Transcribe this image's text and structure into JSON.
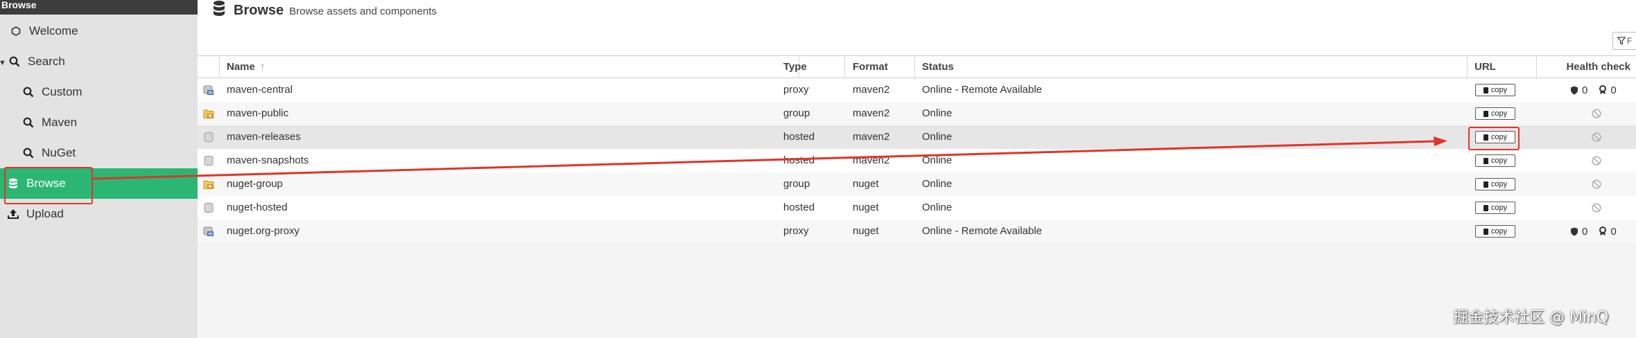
{
  "sidebar": {
    "header": "Browse",
    "items": [
      {
        "label": "Welcome",
        "icon": "hexagon-icon"
      },
      {
        "label": "Search",
        "icon": "search-icon"
      },
      {
        "label": "Custom",
        "icon": "search-icon"
      },
      {
        "label": "Maven",
        "icon": "search-icon"
      },
      {
        "label": "NuGet",
        "icon": "search-icon"
      },
      {
        "label": "Browse",
        "icon": "database-icon",
        "selected": true
      },
      {
        "label": "Upload",
        "icon": "upload-icon"
      }
    ]
  },
  "header": {
    "title": "Browse",
    "subtitle": "Browse assets and components",
    "filter_placeholder": "F"
  },
  "table": {
    "columns": [
      "Name",
      "Type",
      "Format",
      "Status",
      "URL",
      "Health check"
    ],
    "sort_indicator": "↑",
    "rows": [
      {
        "name": "maven-central",
        "type": "proxy",
        "format": "maven2",
        "status": "Online - Remote Available",
        "url": "copy",
        "health": {
          "shield": "0",
          "badge": "0"
        },
        "icon": "proxy-icon"
      },
      {
        "name": "maven-public",
        "type": "group",
        "format": "maven2",
        "status": "Online",
        "url": "copy",
        "health": null,
        "icon": "group-icon"
      },
      {
        "name": "maven-releases",
        "type": "hosted",
        "format": "maven2",
        "status": "Online",
        "url": "copy",
        "health": null,
        "icon": "hosted-icon"
      },
      {
        "name": "maven-snapshots",
        "type": "hosted",
        "format": "maven2",
        "status": "Online",
        "url": "copy",
        "health": null,
        "icon": "hosted-icon"
      },
      {
        "name": "nuget-group",
        "type": "group",
        "format": "nuget",
        "status": "Online",
        "url": "copy",
        "health": null,
        "icon": "group-icon"
      },
      {
        "name": "nuget-hosted",
        "type": "hosted",
        "format": "nuget",
        "status": "Online",
        "url": "copy",
        "health": null,
        "icon": "hosted-icon"
      },
      {
        "name": "nuget.org-proxy",
        "type": "proxy",
        "format": "nuget",
        "status": "Online - Remote Available",
        "url": "copy",
        "health": {
          "shield": "0",
          "badge": "0"
        },
        "icon": "proxy-icon"
      }
    ]
  },
  "watermark": "掘金技术社区 @ MinQ",
  "colors": {
    "accent": "#2cb673",
    "annotation": "#e0342a",
    "sidebar_bg": "#e3e3e3",
    "header_bar": "#3d3d3d"
  }
}
